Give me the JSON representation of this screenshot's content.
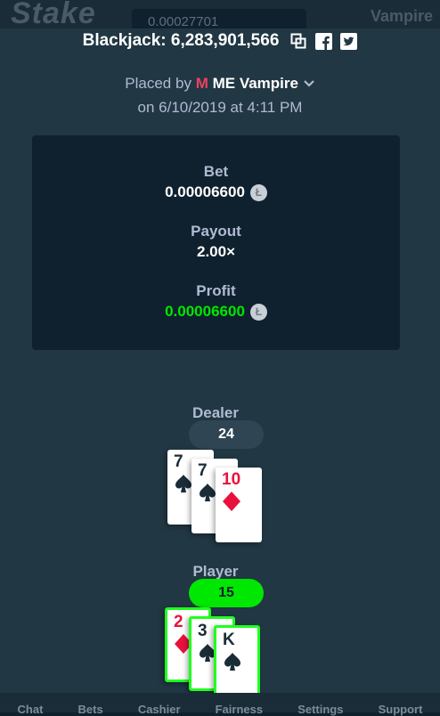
{
  "app": {
    "logo": "Stake",
    "balance": "0.00027701",
    "user": "Vampire"
  },
  "modal": {
    "title": "Blackjack: 6,283,901,566",
    "placed_by_prefix": "Placed by",
    "user_flag": "M",
    "user_name": "ME Vampire",
    "date": "on 6/10/2019 at 4:11 PM"
  },
  "stats": {
    "bet_label": "Bet",
    "bet_value": "0.00006600",
    "payout_label": "Payout",
    "payout_value": "2.00×",
    "profit_label": "Profit",
    "profit_value": "0.00006600",
    "coin_symbol": "Ł"
  },
  "dealer": {
    "label": "Dealer",
    "score": "24",
    "cards": [
      {
        "rank": "7",
        "suit": "spade",
        "color": "black"
      },
      {
        "rank": "7",
        "suit": "spade",
        "color": "black"
      },
      {
        "rank": "10",
        "suit": "diamond",
        "color": "red"
      }
    ]
  },
  "player": {
    "label": "Player",
    "score": "15",
    "cards": [
      {
        "rank": "2",
        "suit": "diamond",
        "color": "red"
      },
      {
        "rank": "3",
        "suit": "spade",
        "color": "black"
      },
      {
        "rank": "K",
        "suit": "spade",
        "color": "black"
      }
    ]
  },
  "nav": {
    "items": [
      "Chat",
      "Bets",
      "Cashier",
      "Fairness",
      "Settings",
      "Support"
    ]
  },
  "colors": {
    "background": "#0f212e",
    "panel": "#213743",
    "win_green": "#00e701",
    "red": "#e9113c"
  }
}
